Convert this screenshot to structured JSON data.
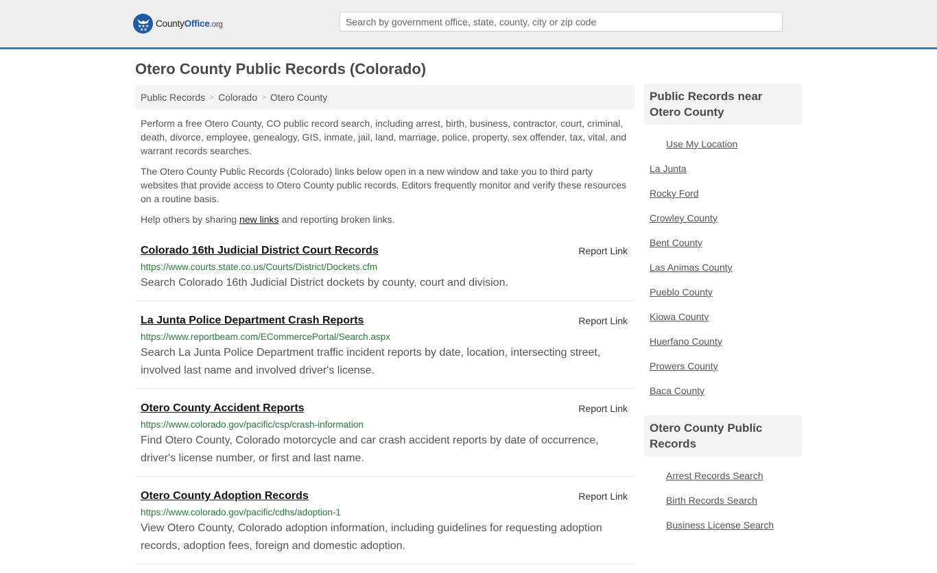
{
  "header": {
    "logo": {
      "icon": "eagle-stars-icon",
      "text_main": "County",
      "text_accent": "Office",
      "text_suffix": ".org"
    },
    "search": {
      "placeholder": "Search by government office, state, county, city or zip code",
      "value": ""
    },
    "colors": {
      "accent": "#3a7cb8",
      "brand_blue": "#1f5aa5",
      "header_bg": "#eeeeee"
    }
  },
  "page": {
    "title": "Otero County Public Records (Colorado)",
    "breadcrumb": [
      "Public Records",
      "Colorado",
      "Otero County"
    ],
    "intro": {
      "p1": "Perform a free Otero County, CO public record search, including arrest, birth, business, contractor, court, criminal, death, divorce, employee, genealogy, GIS, inmate, jail, land, marriage, police, property, sex offender, tax, vital, and warrant records searches.",
      "p2": "The Otero County Public Records (Colorado) links below open in a new window and take you to third party websites that provide access to Otero County public records. Editors frequently monitor and verify these resources on a routine basis.",
      "p3_before": "Help others by sharing ",
      "p3_link": "new links",
      "p3_after": " and reporting broken links."
    },
    "report_label": "Report Link",
    "records": [
      {
        "title": "Colorado 16th Judicial District Court Records",
        "url": "https://www.courts.state.co.us/Courts/District/Dockets.cfm",
        "desc": "Search Colorado 16th Judicial District dockets by county, court and division."
      },
      {
        "title": "La Junta Police Department Crash Reports",
        "url": "https://www.reportbeam.com/ECommercePortal/Search.aspx",
        "desc": "Search La Junta Police Department traffic incident reports by date, location, intersecting street, involved last name and involved driver's license."
      },
      {
        "title": "Otero County Accident Reports",
        "url": "https://www.colorado.gov/pacific/csp/crash-information",
        "desc": "Find Otero County, Colorado motorcycle and car crash accident reports by date of occurrence, driver's license number, or first and last name."
      },
      {
        "title": "Otero County Adoption Records",
        "url": "https://www.colorado.gov/pacific/cdhs/adoption-1",
        "desc": "View Otero County, Colorado adoption information, including guidelines for requesting adoption records, adoption fees, foreign and domestic adoption."
      }
    ]
  },
  "sidebar": {
    "nearby": {
      "heading": "Public Records near Otero County",
      "use_location": "Use My Location",
      "items": [
        "La Junta",
        "Rocky Ford",
        "Crowley County",
        "Bent County",
        "Las Animas County",
        "Pueblo County",
        "Kiowa County",
        "Huerfano County",
        "Prowers County",
        "Baca County"
      ]
    },
    "county_records": {
      "heading": "Otero County Public Records",
      "items": [
        "Arrest Records Search",
        "Birth Records Search",
        "Business License Search"
      ]
    }
  }
}
